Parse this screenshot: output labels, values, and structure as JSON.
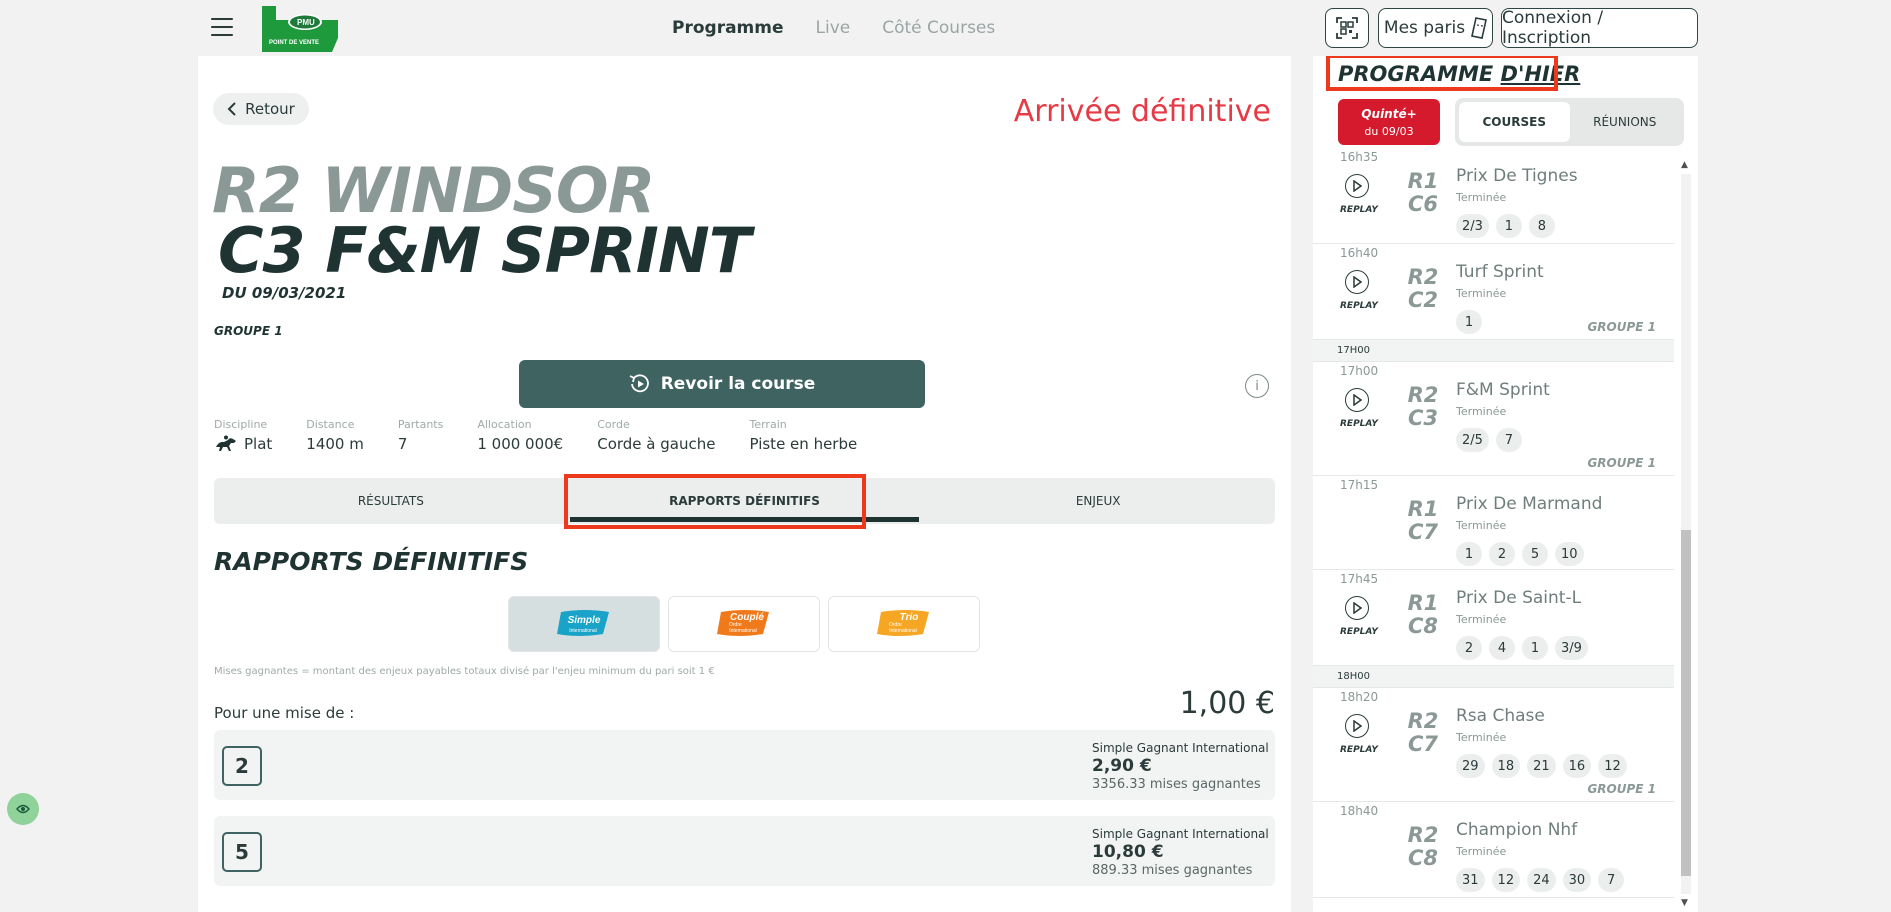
{
  "header": {
    "logo_text": "PMU",
    "logo_sub": "POINT DE VENTE",
    "nav": [
      {
        "label": "Programme"
      },
      {
        "label": "Live"
      },
      {
        "label": "Côté Courses"
      }
    ],
    "mes_paris": "Mes paris",
    "connexion": "Connexion / Inscription"
  },
  "race": {
    "back_label": "Retour",
    "status": "Arrivée définitive",
    "reunion": "R2 WINDSOR",
    "course": "C3 F&M SPRINT",
    "date": "DU 09/03/2021",
    "group": "GROUPE 1",
    "replay_button": "Revoir la course",
    "info_icon": "i",
    "specs": [
      {
        "label": "Discipline",
        "value": "Plat"
      },
      {
        "label": "Distance",
        "value": "1400 m"
      },
      {
        "label": "Partants",
        "value": "7"
      },
      {
        "label": "Allocation",
        "value": "1 000 000€"
      },
      {
        "label": "Corde",
        "value": "Corde à gauche"
      },
      {
        "label": "Terrain",
        "value": "Piste en herbe"
      }
    ],
    "tabs": [
      {
        "label": "RÉSULTATS"
      },
      {
        "label": "RAPPORTS DÉFINITIFS"
      },
      {
        "label": "ENJEUX"
      }
    ]
  },
  "rapports": {
    "title": "RAPPORTS DÉFINITIFS",
    "bet_types": [
      {
        "label": "Simple",
        "sub": "International",
        "color": "#1aa3c8"
      },
      {
        "label": "Couplé",
        "sub": "International",
        "sub2": "Ordre",
        "color": "#f07a1a"
      },
      {
        "label": "Trio",
        "sub": "International",
        "sub2": "Ordre",
        "color": "#f5a623"
      }
    ],
    "note": "Mises gagnantes = montant des enjeux payables totaux divisé par l'enjeu minimum du pari soit 1 €",
    "pour_une_mise": "Pour une mise de :",
    "mise_value": "1,00 €",
    "results": [
      {
        "horse": "2",
        "type": "Simple Gagnant International",
        "price": "2,90 €",
        "mises": "3356.33 mises gagnantes"
      },
      {
        "horse": "5",
        "type": "Simple Gagnant International",
        "price": "10,80 €",
        "mises": "889.33 mises gagnantes"
      }
    ]
  },
  "sidebar": {
    "title_part1": "PROGRAMME ",
    "title_part2": "D'HIER",
    "quinte_label": "Quinté+",
    "quinte_date": "du 09/03",
    "toggle": [
      {
        "label": "COURSES"
      },
      {
        "label": "RÉUNIONS"
      }
    ],
    "replay_label": "REPLAY",
    "races": [
      {
        "time": "16h35",
        "r": "R1",
        "c": "C6",
        "name": "Prix De Tignes",
        "status": "Terminée",
        "nums": [
          "2/3",
          "1",
          "8"
        ],
        "replay": true,
        "group": ""
      },
      {
        "time": "16h40",
        "r": "R2",
        "c": "C2",
        "name": "Turf Sprint",
        "status": "Terminée",
        "nums": [
          "1"
        ],
        "replay": true,
        "group": "GROUPE 1"
      },
      {
        "separator": "17H00"
      },
      {
        "time": "17h00",
        "r": "R2",
        "c": "C3",
        "name": "F&M Sprint",
        "status": "Terminée",
        "nums": [
          "2/5",
          "7"
        ],
        "replay": true,
        "group": "GROUPE 1"
      },
      {
        "time": "17h15",
        "r": "R1",
        "c": "C7",
        "name": "Prix De Marmand",
        "status": "Terminée",
        "nums": [
          "1",
          "2",
          "5",
          "10"
        ],
        "replay": false,
        "group": ""
      },
      {
        "time": "17h45",
        "r": "R1",
        "c": "C8",
        "name": "Prix De Saint-L",
        "status": "Terminée",
        "nums": [
          "2",
          "4",
          "1",
          "3/9"
        ],
        "replay": true,
        "group": ""
      },
      {
        "separator": "18H00"
      },
      {
        "time": "18h20",
        "r": "R2",
        "c": "C7",
        "name": "Rsa Chase",
        "status": "Terminée",
        "nums": [
          "29",
          "18",
          "21",
          "16",
          "12"
        ],
        "replay": true,
        "group": "GROUPE 1"
      },
      {
        "time": "18h40",
        "r": "R2",
        "c": "C8",
        "name": "Champion Nhf",
        "status": "Terminée",
        "nums": [
          "31",
          "12",
          "24",
          "30",
          "7"
        ],
        "replay": false,
        "group": ""
      }
    ]
  },
  "colors": {
    "accent_red": "#e63a46",
    "dark_green": "#1f3432",
    "button_green": "#3f6361",
    "highlight": "#ee3a1c"
  }
}
